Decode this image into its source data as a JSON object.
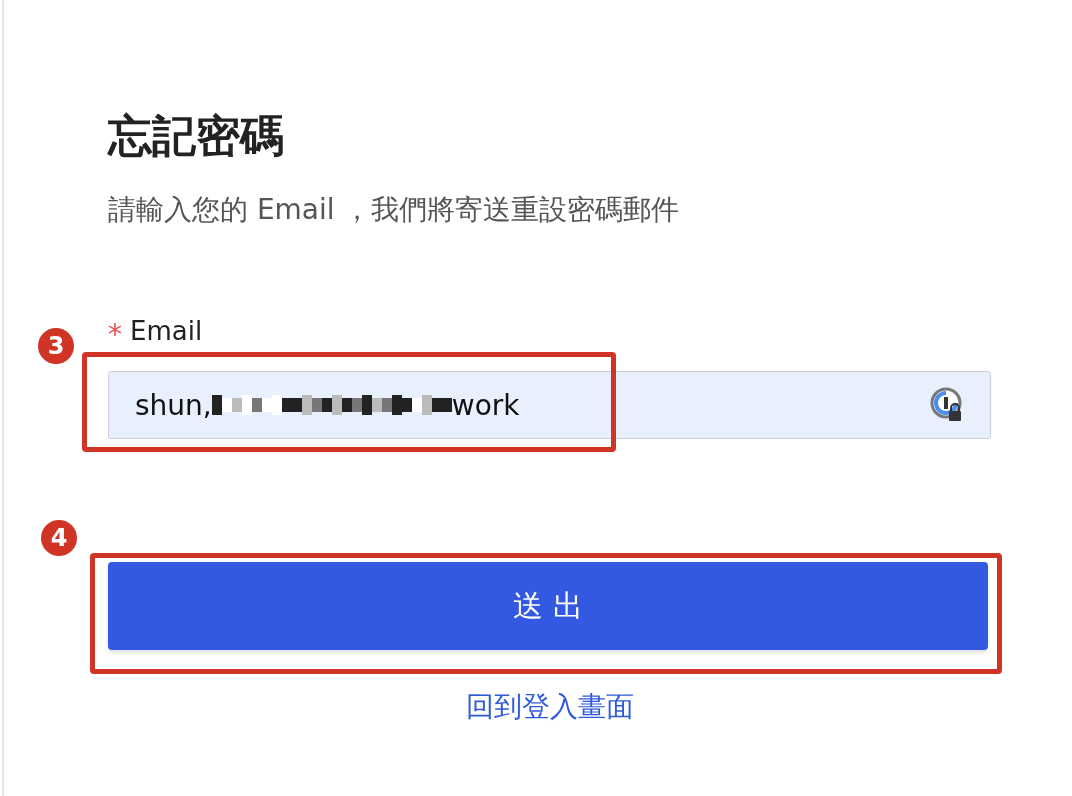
{
  "title": "忘記密碼",
  "subtitle": "請輸入您的 Email ，我們將寄送重設密碼郵件",
  "email_field": {
    "label": "Email",
    "required_mark": "*",
    "value_start": "shun,",
    "value_end": "work",
    "redacted": true
  },
  "submit_button": "送 出",
  "back_link": "回到登入畫面",
  "annotations": [
    {
      "number": "3"
    },
    {
      "number": "4"
    }
  ]
}
